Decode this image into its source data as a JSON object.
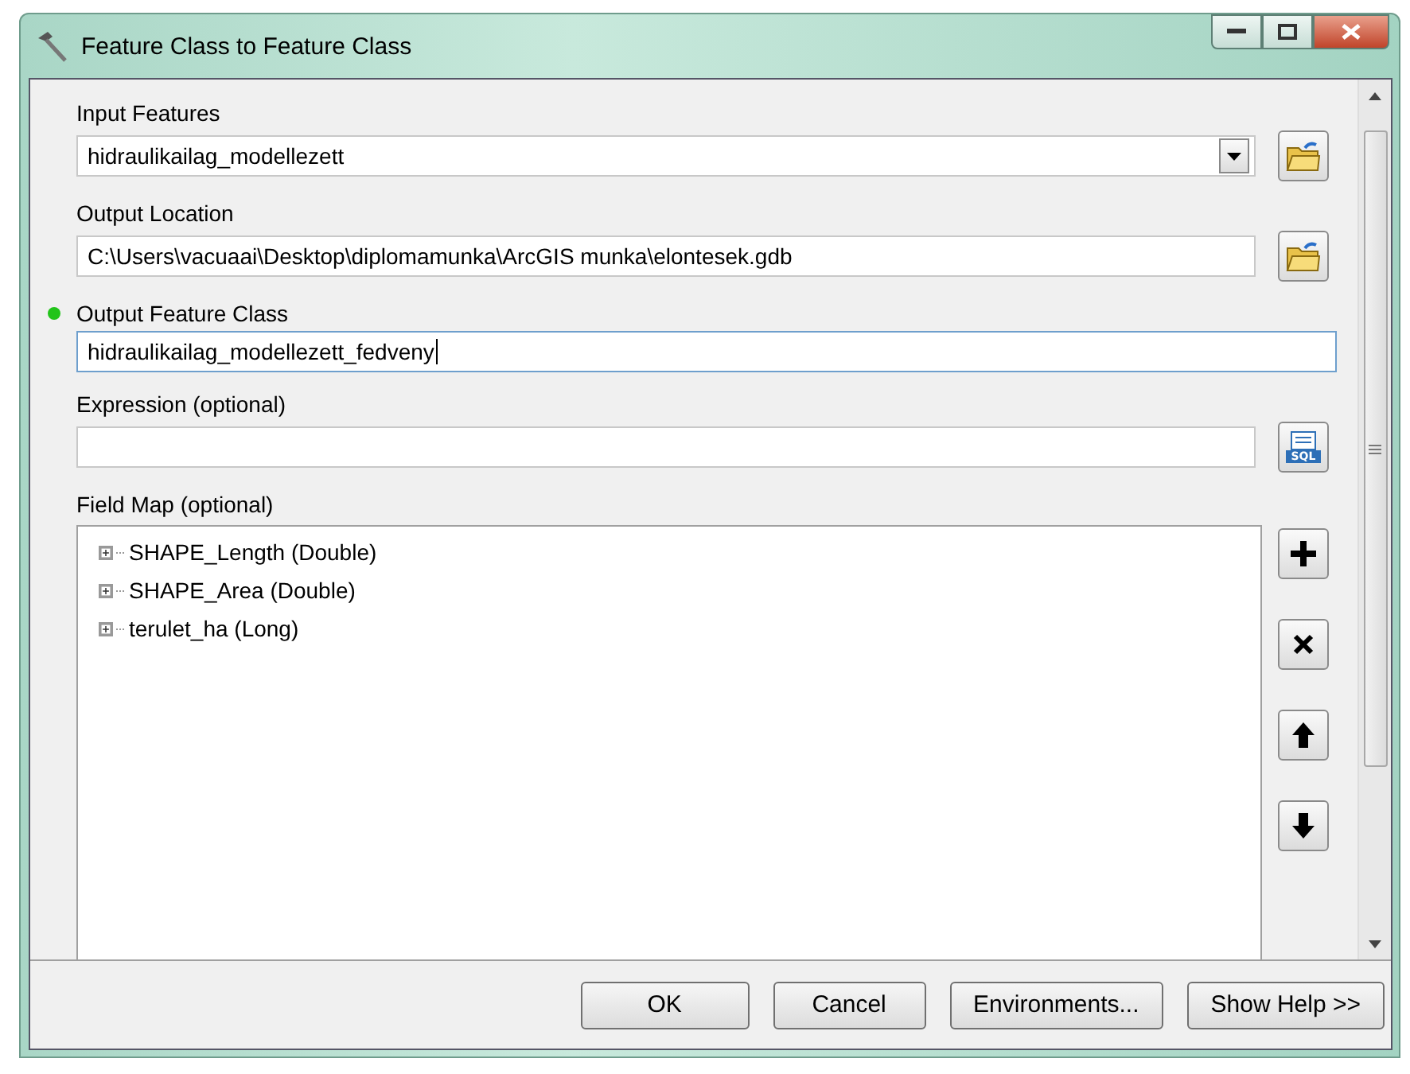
{
  "window": {
    "title": "Feature Class to Feature Class"
  },
  "parameters": [
    {
      "label": "Input Features",
      "kind": "dropdown",
      "value": "hidraulikailag_modellezett",
      "button": {
        "kind": "folder"
      },
      "indicator": false,
      "focused": false
    },
    {
      "label": "Output Location",
      "kind": "text",
      "value": "C:\\Users\\vacuaai\\Desktop\\diplomamunka\\ArcGIS munka\\elontesek.gdb",
      "button": {
        "kind": "folder"
      },
      "indicator": false,
      "focused": false
    },
    {
      "label": "Output Feature Class",
      "kind": "text",
      "value": "hidraulikailag_modellezett_fedveny",
      "indicator": true,
      "focused": true
    },
    {
      "label": "Expression (optional)",
      "kind": "text",
      "button": {
        "kind": "sql",
        "text": "SQL"
      },
      "indicator": false,
      "focused": false
    }
  ],
  "field_map": {
    "label": "Field Map (optional)",
    "items": [
      {
        "label": "SHAPE_Length (Double)",
        "expanded": false
      },
      {
        "label": "SHAPE_Area (Double)",
        "expanded": false
      },
      {
        "label": "terulet_ha (Long)",
        "expanded": false
      }
    ]
  },
  "buttons": [
    "OK",
    "Cancel",
    "Environments...",
    "Show Help >>"
  ]
}
